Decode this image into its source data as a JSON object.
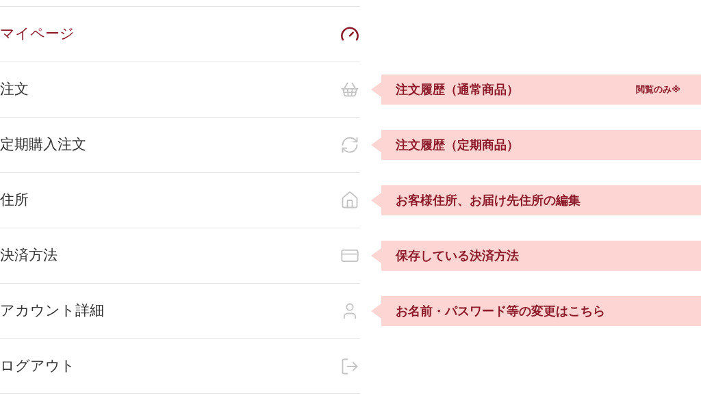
{
  "menu": [
    {
      "label": "マイページ",
      "selected": true
    },
    {
      "label": "注文",
      "selected": false,
      "note": {
        "text": "注文履歴（通常商品）",
        "badge": "閲覧のみ※"
      }
    },
    {
      "label": "定期購入注文",
      "selected": false,
      "note": {
        "text": "注文履歴（定期商品）"
      }
    },
    {
      "label": "住所",
      "selected": false,
      "note": {
        "text": "お客様住所、お届け先住所の編集"
      }
    },
    {
      "label": "決済方法",
      "selected": false,
      "note": {
        "text": "保存している決済方法"
      }
    },
    {
      "label": "アカウント詳細",
      "selected": false,
      "note": {
        "text": "お名前・パスワード等の変更はこちら"
      }
    },
    {
      "label": "ログアウト",
      "selected": false
    }
  ]
}
